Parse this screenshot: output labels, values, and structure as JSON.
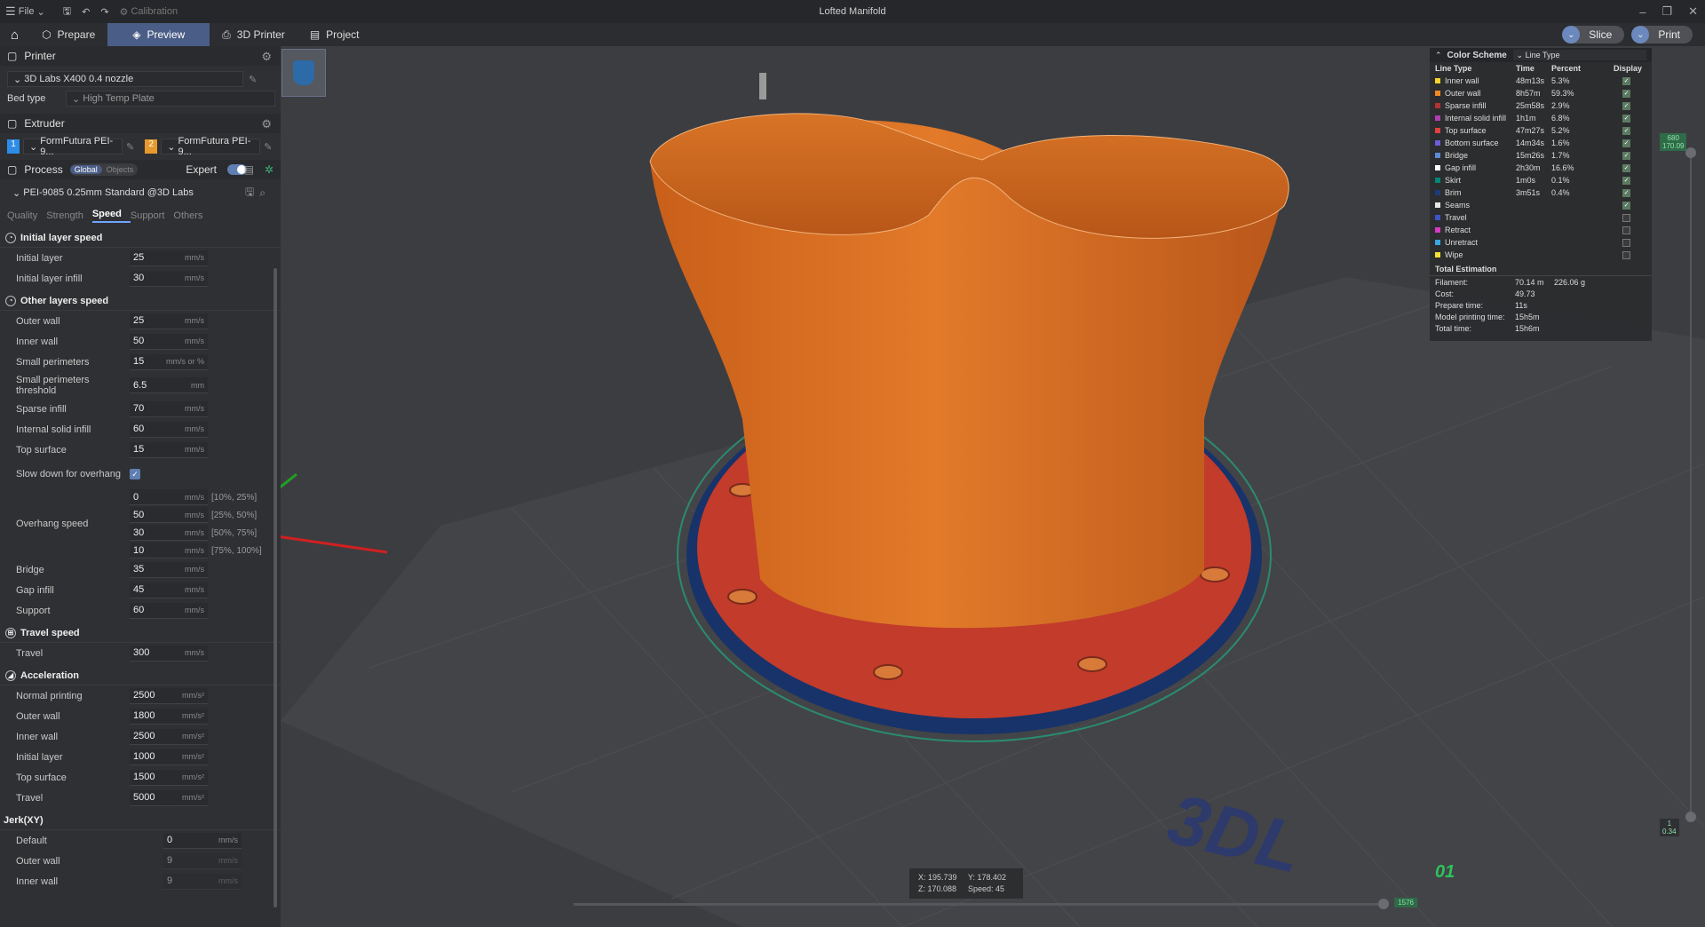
{
  "titlebar": {
    "file_label": "File",
    "calibration_label": "Calibration",
    "window_title": "Lofted Manifold"
  },
  "nav": {
    "tabs": [
      {
        "label": "Prepare"
      },
      {
        "label": "Preview"
      },
      {
        "label": "3D Printer"
      },
      {
        "label": "Project"
      }
    ],
    "slice_label": "Slice",
    "print_label": "Print"
  },
  "printer": {
    "section_label": "Printer",
    "name": "3D Labs X400 0.4 nozzle",
    "bed_type_label": "Bed type",
    "bed_type_value": "High Temp Plate"
  },
  "extruder": {
    "section_label": "Extruder",
    "e1_num": "1",
    "e1_name": "FormFutura PEI-9...",
    "e2_num": "2",
    "e2_name": "FormFutura PEI-9..."
  },
  "process": {
    "section_label": "Process",
    "global_label": "Global",
    "objects_label": "Objects",
    "expert_label": "Expert",
    "profile": "PEI-9085 0.25mm Standard @3D Labs",
    "subtabs": [
      "Quality",
      "Strength",
      "Speed",
      "Support",
      "Others"
    ]
  },
  "speed": {
    "g1": "Initial layer speed",
    "initial_layer": {
      "label": "Initial layer",
      "value": "25",
      "unit": "mm/s"
    },
    "initial_layer_infill": {
      "label": "Initial layer infill",
      "value": "30",
      "unit": "mm/s"
    },
    "g2": "Other layers speed",
    "outer_wall": {
      "label": "Outer wall",
      "value": "25",
      "unit": "mm/s"
    },
    "inner_wall": {
      "label": "Inner wall",
      "value": "50",
      "unit": "mm/s"
    },
    "small_perimeters": {
      "label": "Small perimeters",
      "value": "15",
      "unit": "mm/s or %"
    },
    "small_perimeters_threshold": {
      "label": "Small perimeters threshold",
      "value": "6.5",
      "unit": "mm"
    },
    "sparse_infill": {
      "label": "Sparse infill",
      "value": "70",
      "unit": "mm/s"
    },
    "internal_solid_infill": {
      "label": "Internal solid infill",
      "value": "60",
      "unit": "mm/s"
    },
    "top_surface": {
      "label": "Top surface",
      "value": "15",
      "unit": "mm/s"
    },
    "slow_down_label": "Slow down for overhang",
    "overhang_label": "Overhang speed",
    "overhang": [
      {
        "value": "0",
        "unit": "mm/s",
        "range": "[10%, 25%]"
      },
      {
        "value": "50",
        "unit": "mm/s",
        "range": "[25%, 50%]"
      },
      {
        "value": "30",
        "unit": "mm/s",
        "range": "[50%, 75%]"
      },
      {
        "value": "10",
        "unit": "mm/s",
        "range": "[75%, 100%]"
      }
    ],
    "bridge": {
      "label": "Bridge",
      "value": "35",
      "unit": "mm/s"
    },
    "gap_infill": {
      "label": "Gap infill",
      "value": "45",
      "unit": "mm/s"
    },
    "support": {
      "label": "Support",
      "value": "60",
      "unit": "mm/s"
    },
    "g3": "Travel speed",
    "travel": {
      "label": "Travel",
      "value": "300",
      "unit": "mm/s"
    },
    "g4": "Acceleration",
    "acc_normal": {
      "label": "Normal printing",
      "value": "2500",
      "unit": "mm/s²"
    },
    "acc_outer": {
      "label": "Outer wall",
      "value": "1800",
      "unit": "mm/s²"
    },
    "acc_inner": {
      "label": "Inner wall",
      "value": "2500",
      "unit": "mm/s²"
    },
    "acc_initial": {
      "label": "Initial layer",
      "value": "1000",
      "unit": "mm/s²"
    },
    "acc_top": {
      "label": "Top surface",
      "value": "1500",
      "unit": "mm/s²"
    },
    "acc_travel": {
      "label": "Travel",
      "value": "5000",
      "unit": "mm/s²"
    },
    "g5": "Jerk(XY)",
    "jerk_default": {
      "label": "Default",
      "value": "0",
      "unit": "mm/s"
    },
    "jerk_outer": {
      "label": "Outer wall",
      "value": "9",
      "unit": "mm/s"
    },
    "jerk_inner": {
      "label": "Inner wall",
      "value": "9",
      "unit": "mm/s"
    }
  },
  "legend": {
    "title": "Color Scheme",
    "scheme": "Line Type",
    "headers": {
      "type": "Line Type",
      "time": "Time",
      "percent": "Percent",
      "display": "Display"
    },
    "rows": [
      {
        "name": "Inner wall",
        "time": "48m13s",
        "percent": "5.3%",
        "color": "#f5d328",
        "on": true
      },
      {
        "name": "Outer wall",
        "time": "8h57m",
        "percent": "59.3%",
        "color": "#f08a24",
        "on": true
      },
      {
        "name": "Sparse infill",
        "time": "25m58s",
        "percent": "2.9%",
        "color": "#b43232",
        "on": true
      },
      {
        "name": "Internal solid infill",
        "time": "1h1m",
        "percent": "6.8%",
        "color": "#b23cb2",
        "on": true
      },
      {
        "name": "Top surface",
        "time": "47m27s",
        "percent": "5.2%",
        "color": "#e04040",
        "on": true
      },
      {
        "name": "Bottom surface",
        "time": "14m34s",
        "percent": "1.6%",
        "color": "#6a5fd8",
        "on": true
      },
      {
        "name": "Bridge",
        "time": "15m26s",
        "percent": "1.7%",
        "color": "#5b8bd4",
        "on": true
      },
      {
        "name": "Gap infill",
        "time": "2h30m",
        "percent": "16.6%",
        "color": "#ffffff",
        "on": true
      },
      {
        "name": "Skirt",
        "time": "1m0s",
        "percent": "0.1%",
        "color": "#00877a",
        "on": true
      },
      {
        "name": "Brim",
        "time": "3m51s",
        "percent": "0.4%",
        "color": "#1a3c7a",
        "on": true
      },
      {
        "name": "Seams",
        "time": "",
        "percent": "",
        "color": "#e6e6e6",
        "on": true
      },
      {
        "name": "Travel",
        "time": "",
        "percent": "",
        "color": "#3a56c8",
        "on": false
      },
      {
        "name": "Retract",
        "time": "",
        "percent": "",
        "color": "#d838c8",
        "on": false
      },
      {
        "name": "Unretract",
        "time": "",
        "percent": "",
        "color": "#38a8e0",
        "on": false
      },
      {
        "name": "Wipe",
        "time": "",
        "percent": "",
        "color": "#f0e030",
        "on": false
      }
    ],
    "total_label": "Total Estimation",
    "filament_label": "Filament:",
    "filament_m": "70.14 m",
    "filament_g": "226.06 g",
    "cost_label": "Cost:",
    "cost": "49.73",
    "prepare_label": "Prepare time:",
    "prepare": "11s",
    "model_label": "Model printing time:",
    "model": "15h5m",
    "total_time_label": "Total time:",
    "total_time": "15h6m"
  },
  "coord": {
    "x": "X: 195.739",
    "y": "Y: 178.402",
    "z": "Z: 170.088",
    "speed": "Speed: 45"
  },
  "sliders": {
    "top_layer": "680",
    "top_height": "170.09",
    "bottom_layer": "1",
    "bottom_height": "0.34",
    "moves": "1576"
  },
  "plate_num": "01"
}
